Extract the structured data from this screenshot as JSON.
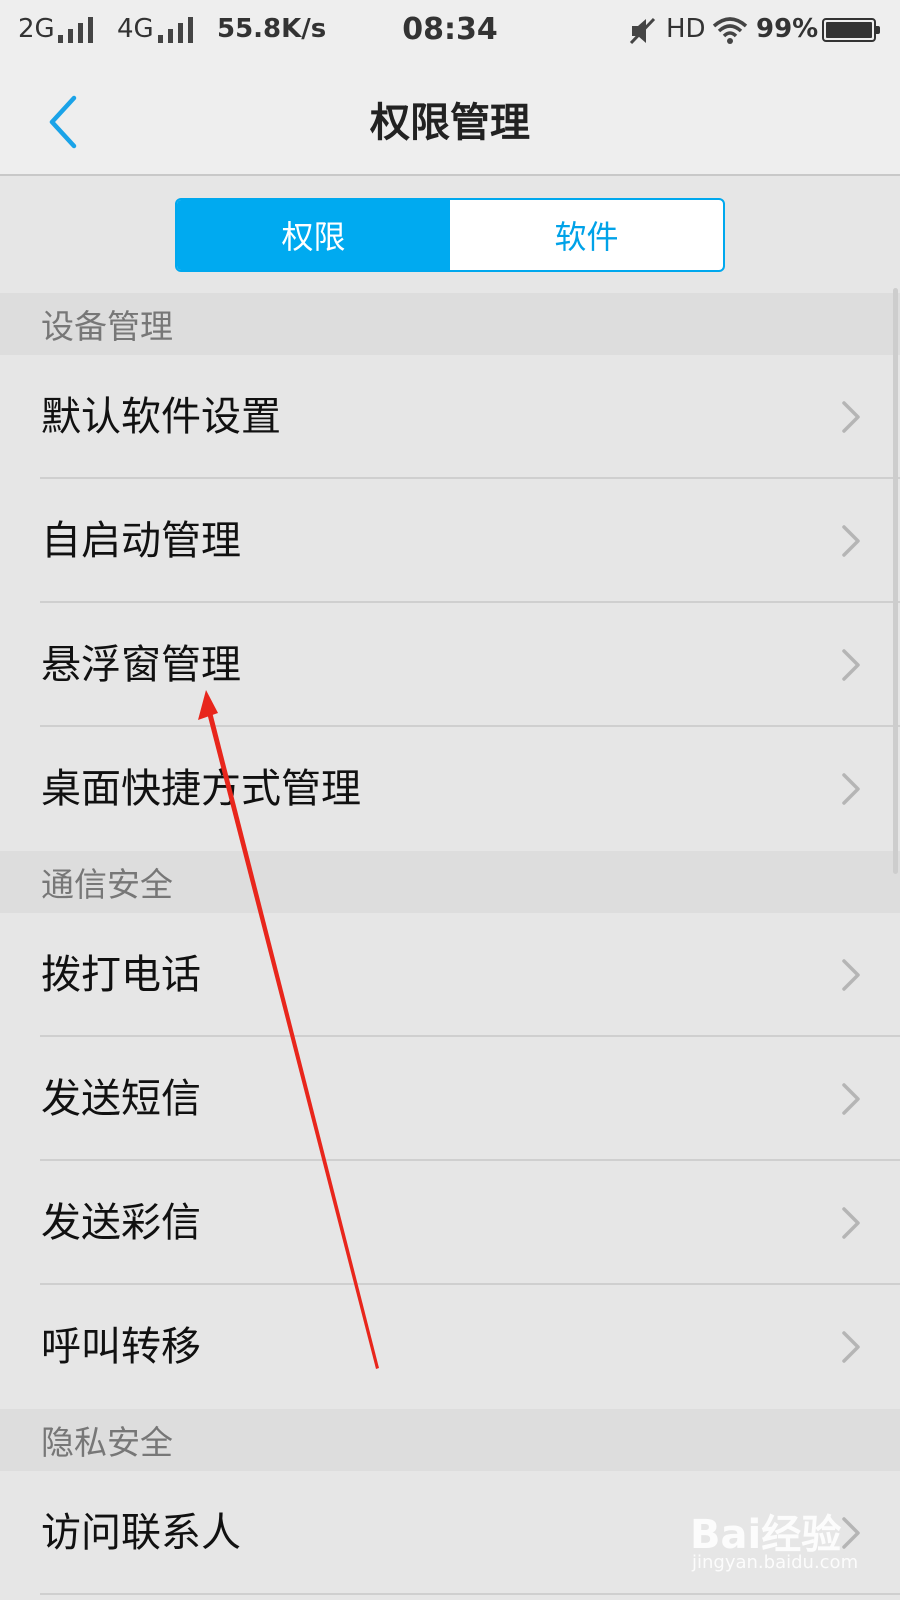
{
  "status_bar": {
    "net1": "2G",
    "net2": "4G",
    "speed": "55.8K/s",
    "time": "08:34",
    "hd": "HD",
    "battery": "99%",
    "battery_level": 0.99
  },
  "header": {
    "title": "权限管理",
    "back_icon": "chevron-left-icon"
  },
  "tabs": [
    {
      "label": "权限",
      "active": true
    },
    {
      "label": "软件",
      "active": false
    }
  ],
  "sections": [
    {
      "title": "设备管理",
      "items": [
        {
          "label": "默认软件设置"
        },
        {
          "label": "自启动管理"
        },
        {
          "label": "悬浮窗管理"
        },
        {
          "label": "桌面快捷方式管理"
        }
      ]
    },
    {
      "title": "通信安全",
      "items": [
        {
          "label": "拨打电话"
        },
        {
          "label": "发送短信"
        },
        {
          "label": "发送彩信"
        },
        {
          "label": "呼叫转移"
        }
      ]
    },
    {
      "title": "隐私安全",
      "items": [
        {
          "label": "访问联系人"
        }
      ]
    }
  ],
  "watermark": {
    "logo": "Bai经验",
    "url": "jingyan.baidu.com"
  },
  "colors": {
    "accent": "#00aaf0",
    "annotation_arrow": "#e8261c"
  }
}
